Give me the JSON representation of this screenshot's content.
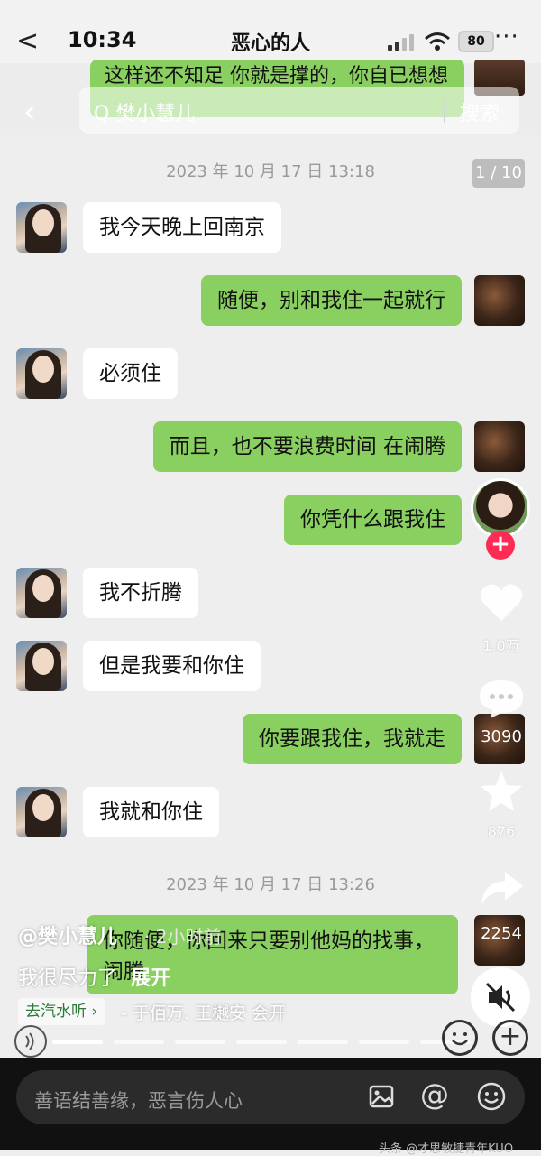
{
  "status_bar": {
    "back": "<",
    "time": "10:34",
    "battery": "80",
    "more": "···"
  },
  "chat": {
    "title": "恶心的人",
    "top_partial_message": "这样还不知足 你就是撑的，你自已想想",
    "search": {
      "query": "Q 樊小慧儿",
      "button": "搜索"
    },
    "page_indicator": "1 / 10",
    "timestamps": [
      "2023 年 10 月 17 日 13:18",
      "2023 年 10 月 17 日 13:26"
    ],
    "messages": [
      {
        "side": "left",
        "text": "我今天晚上回南京"
      },
      {
        "side": "right",
        "text": "随便，别和我住一起就行"
      },
      {
        "side": "left",
        "text": "必须住"
      },
      {
        "side": "right",
        "text": "而且，也不要浪费时间 在闹腾"
      },
      {
        "side": "right",
        "text": "你凭什么跟我住"
      },
      {
        "side": "left",
        "text": "我不折腾"
      },
      {
        "side": "left",
        "text": "但是我要和你住"
      },
      {
        "side": "right",
        "text": "你要跟我住，我就走"
      },
      {
        "side": "left",
        "text": "我就和你住"
      },
      {
        "side": "right",
        "text": "你随便，你回来只要别他妈的找事，闹腾"
      }
    ]
  },
  "video": {
    "author": "@樊小慧儿",
    "time_ago": "· 2小时前",
    "description": "我很尽力了",
    "expand": "展开",
    "tag": "去汽水听 ›",
    "music": "- 于佰万.   王樾安 会开",
    "likes": "1.0万",
    "comments": "3090",
    "favorites": "876",
    "shares": "2254"
  },
  "comment_bar": {
    "placeholder": "善语结善缘，恶言伤人心"
  },
  "watermark": "头条 @才思敏捷青年KUO",
  "colors": {
    "bubble_green": "#8ad061",
    "follow_red": "#fe2c55"
  }
}
